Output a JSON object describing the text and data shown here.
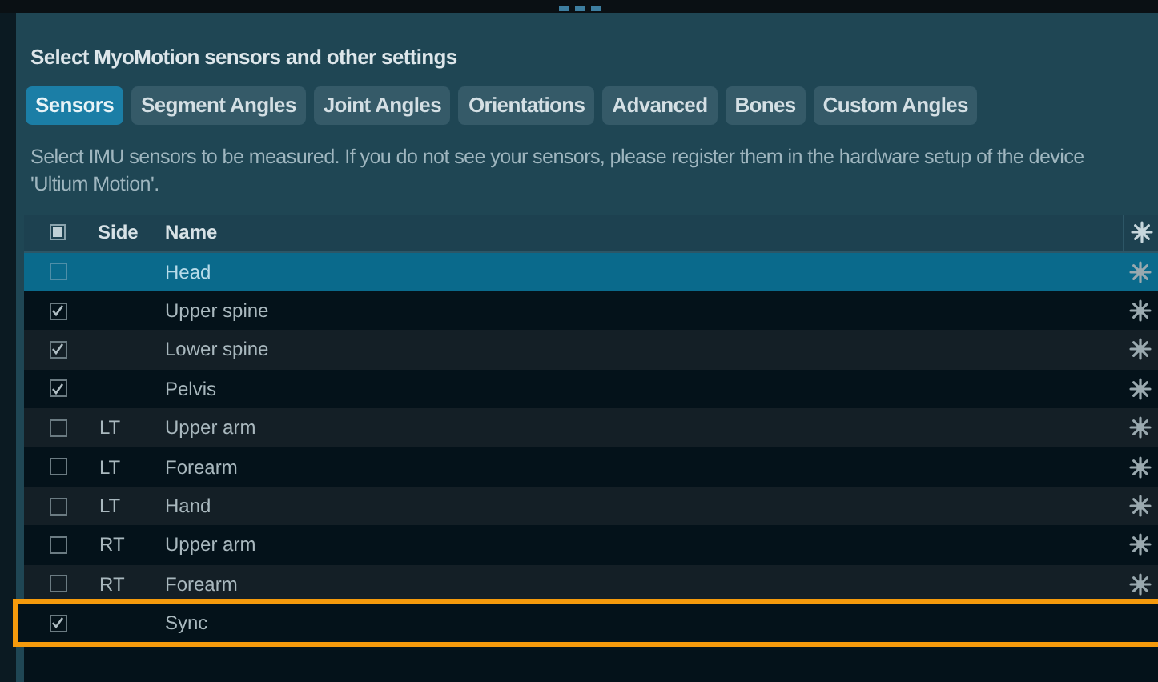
{
  "title": "Select MyoMotion sensors and other settings",
  "tabs": [
    {
      "label": "Sensors",
      "selected": true
    },
    {
      "label": "Segment Angles",
      "selected": false
    },
    {
      "label": "Joint Angles",
      "selected": false
    },
    {
      "label": "Orientations",
      "selected": false
    },
    {
      "label": "Advanced",
      "selected": false
    },
    {
      "label": "Bones",
      "selected": false
    },
    {
      "label": "Custom Angles",
      "selected": false
    }
  ],
  "description": "Select IMU sensors to be measured. If you do not see your sensors, please register them in the hardware setup of the device 'Ultium Motion'.",
  "table": {
    "header_indeterminate": true,
    "columns": [
      "Side",
      "Name"
    ],
    "rows": [
      {
        "side": "",
        "name": "Head",
        "checked": false,
        "selected": true,
        "highlighted": false,
        "settings": true
      },
      {
        "side": "",
        "name": "Upper spine",
        "checked": true,
        "selected": false,
        "highlighted": false,
        "settings": true
      },
      {
        "side": "",
        "name": "Lower spine",
        "checked": true,
        "selected": false,
        "highlighted": false,
        "settings": true
      },
      {
        "side": "",
        "name": "Pelvis",
        "checked": true,
        "selected": false,
        "highlighted": false,
        "settings": true
      },
      {
        "side": "LT",
        "name": "Upper arm",
        "checked": false,
        "selected": false,
        "highlighted": false,
        "settings": true
      },
      {
        "side": "LT",
        "name": "Forearm",
        "checked": false,
        "selected": false,
        "highlighted": false,
        "settings": true
      },
      {
        "side": "LT",
        "name": "Hand",
        "checked": false,
        "selected": false,
        "highlighted": false,
        "settings": true
      },
      {
        "side": "RT",
        "name": "Upper arm",
        "checked": false,
        "selected": false,
        "highlighted": false,
        "settings": true
      },
      {
        "side": "RT",
        "name": "Forearm",
        "checked": false,
        "selected": false,
        "highlighted": false,
        "settings": true
      },
      {
        "side": "",
        "name": "Sync",
        "checked": true,
        "selected": false,
        "highlighted": true,
        "settings": false
      }
    ]
  }
}
